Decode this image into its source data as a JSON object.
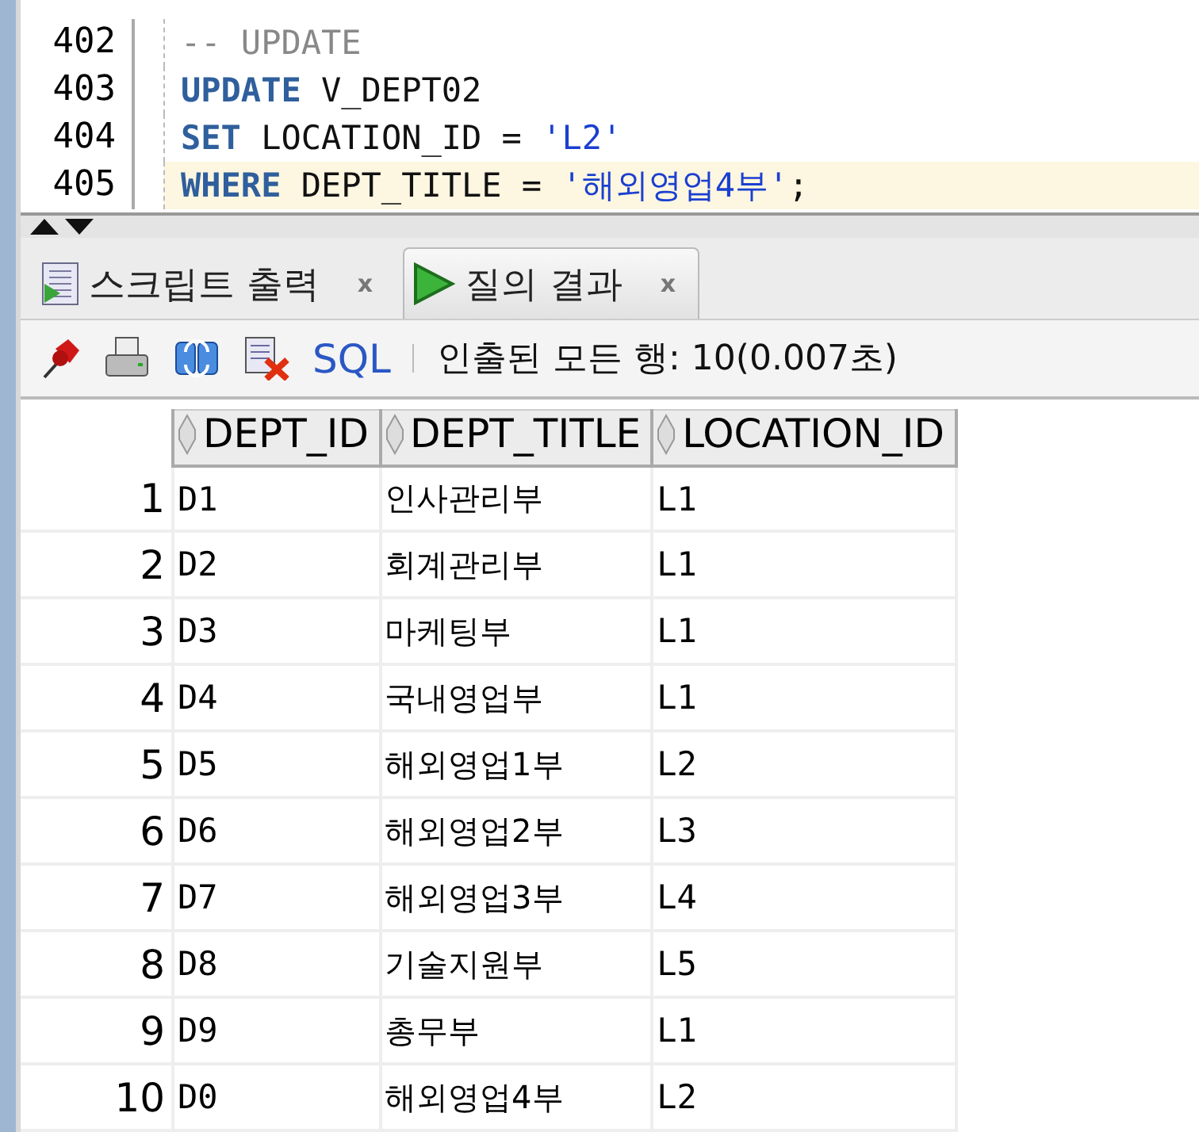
{
  "editor": {
    "lines": [
      {
        "number": "402",
        "current": false,
        "tokens": [
          {
            "kind": "comment",
            "text": "-- UPDATE"
          }
        ]
      },
      {
        "number": "403",
        "current": false,
        "tokens": [
          {
            "kind": "keyword",
            "text": "UPDATE"
          },
          {
            "kind": "plain",
            "text": " V_DEPT02"
          }
        ]
      },
      {
        "number": "404",
        "current": false,
        "tokens": [
          {
            "kind": "keyword",
            "text": "SET"
          },
          {
            "kind": "plain",
            "text": " LOCATION_ID = "
          },
          {
            "kind": "string",
            "text": "'L2'"
          }
        ]
      },
      {
        "number": "405",
        "current": true,
        "tokens": [
          {
            "kind": "keyword",
            "text": "WHERE"
          },
          {
            "kind": "plain",
            "text": " DEPT_TITLE = "
          },
          {
            "kind": "string",
            "text": "'해외영업4부'"
          },
          {
            "kind": "plain",
            "text": ";"
          }
        ]
      }
    ]
  },
  "tabs": [
    {
      "label": "스크립트 출력",
      "kind": "script",
      "selected": false,
      "close": "x"
    },
    {
      "label": "질의 결과",
      "kind": "play",
      "selected": true,
      "close": "x"
    }
  ],
  "toolbar": {
    "sql_label": "SQL",
    "status": "인출된 모든 행: 10(0.007초)"
  },
  "table": {
    "columns": [
      "DEPT_ID",
      "DEPT_TITLE",
      "LOCATION_ID"
    ],
    "rows": [
      {
        "number": "1",
        "cells": [
          "D1",
          "인사관리부",
          "L1"
        ]
      },
      {
        "number": "2",
        "cells": [
          "D2",
          "회계관리부",
          "L1"
        ]
      },
      {
        "number": "3",
        "cells": [
          "D3",
          "마케팅부",
          "L1"
        ]
      },
      {
        "number": "4",
        "cells": [
          "D4",
          "국내영업부",
          "L1"
        ]
      },
      {
        "number": "5",
        "cells": [
          "D5",
          "해외영업1부",
          "L2"
        ]
      },
      {
        "number": "6",
        "cells": [
          "D6",
          "해외영업2부",
          "L3"
        ]
      },
      {
        "number": "7",
        "cells": [
          "D7",
          "해외영업3부",
          "L4"
        ]
      },
      {
        "number": "8",
        "cells": [
          "D8",
          "기술지원부",
          "L5"
        ]
      },
      {
        "number": "9",
        "cells": [
          "D9",
          "총무부",
          "L1"
        ]
      },
      {
        "number": "10",
        "cells": [
          "D0",
          "해외영업4부",
          "L2"
        ]
      }
    ]
  }
}
